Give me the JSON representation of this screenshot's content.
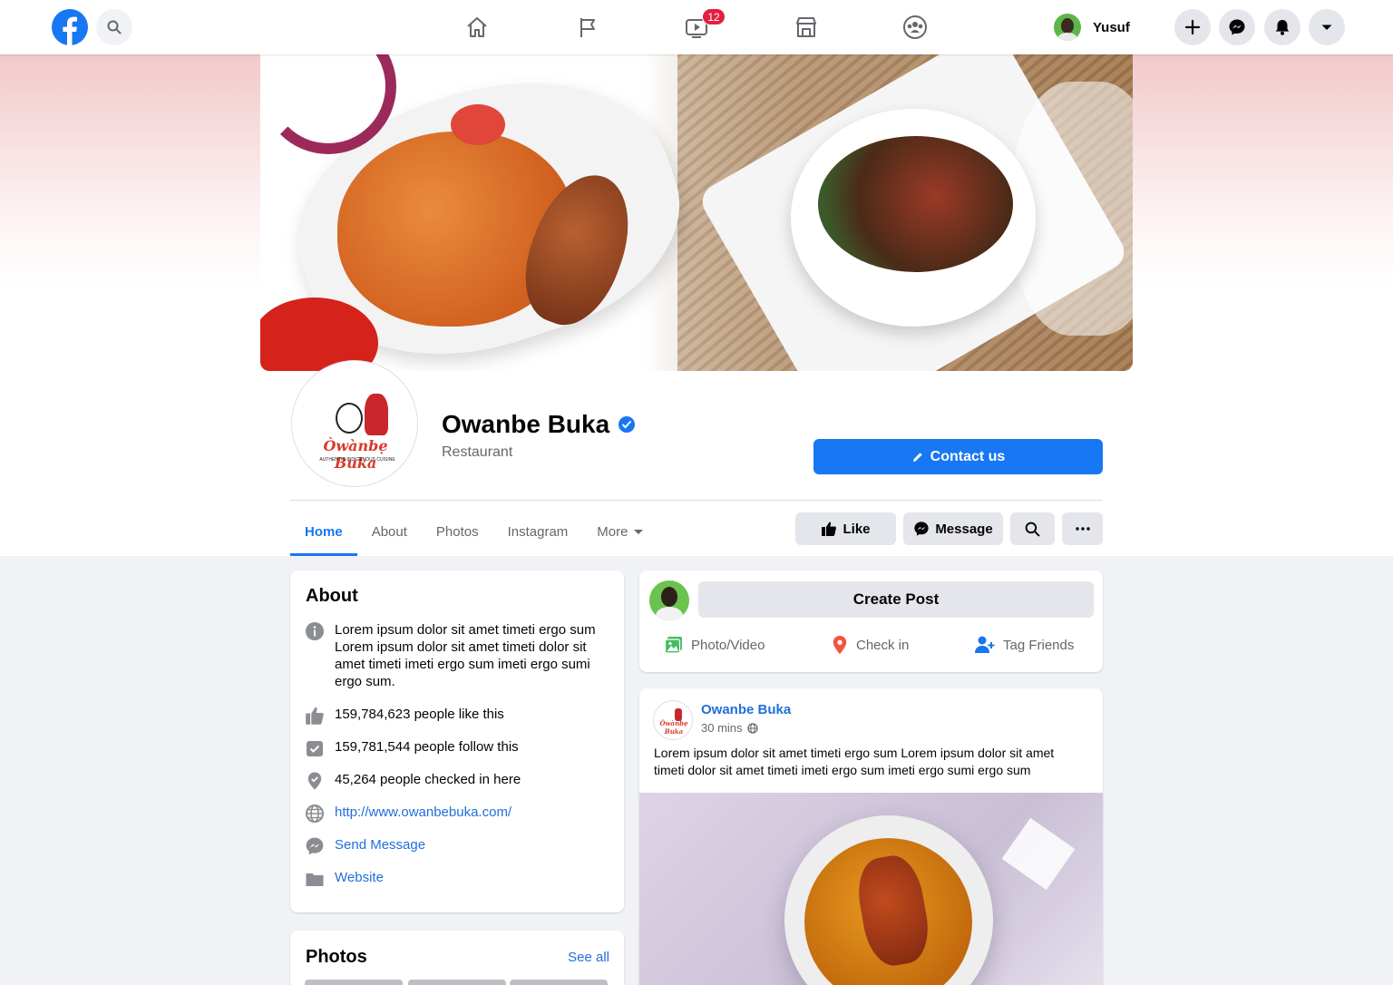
{
  "topbar": {
    "logo_icon": "facebook-logo-icon",
    "search_icon": "search-icon",
    "nav": [
      {
        "icon": "home-icon"
      },
      {
        "icon": "flag-icon"
      },
      {
        "icon": "watch-icon",
        "badge": "12"
      },
      {
        "icon": "marketplace-icon"
      },
      {
        "icon": "groups-icon"
      }
    ],
    "profile_name": "Yusuf",
    "actions": [
      {
        "icon": "plus-icon"
      },
      {
        "icon": "messenger-icon"
      },
      {
        "icon": "bell-icon"
      },
      {
        "icon": "caret-down-icon"
      }
    ]
  },
  "page": {
    "name": "Owanbe Buka",
    "category": "Restaurant",
    "logo_text": "Òwànbẹ Buka",
    "logo_subtext": "AUTHENTIC INDIGENOUS CUISINE",
    "contact_label": "Contact us"
  },
  "tabs": [
    {
      "label": "Home",
      "active": true
    },
    {
      "label": "About"
    },
    {
      "label": "Photos"
    },
    {
      "label": "Instagram"
    },
    {
      "label": "More"
    }
  ],
  "action_buttons": {
    "like": "Like",
    "message": "Message"
  },
  "about": {
    "title": "About",
    "description": "Lorem ipsum dolor sit amet timeti ergo sum Lorem ipsum dolor sit amet timeti dolor sit amet timeti imeti ergo sum imeti ergo sumi ergo sum.",
    "likes": "159,784,623 people like this",
    "follows": "159,781,544 people follow this",
    "checkins": "45,264 people checked in here",
    "url": "http://www.owanbebuka.com/",
    "send_message": "Send Message",
    "website": "Website"
  },
  "photos": {
    "title": "Photos",
    "see_all": "See all"
  },
  "create_post": {
    "label": "Create Post",
    "photo_video": "Photo/Video",
    "check_in": "Check in",
    "tag_friends": "Tag Friends"
  },
  "post": {
    "author": "Owanbe Buka",
    "time": "30 mins",
    "text": "Lorem ipsum dolor sit amet timeti ergo sum Lorem ipsum dolor sit amet timeti dolor sit amet timeti imeti ergo sum imeti ergo sumi ergo sum"
  },
  "colors": {
    "brand": "#1877f2",
    "link": "#216fdb",
    "badge": "#e41e3f",
    "background": "#f0f2f5"
  }
}
